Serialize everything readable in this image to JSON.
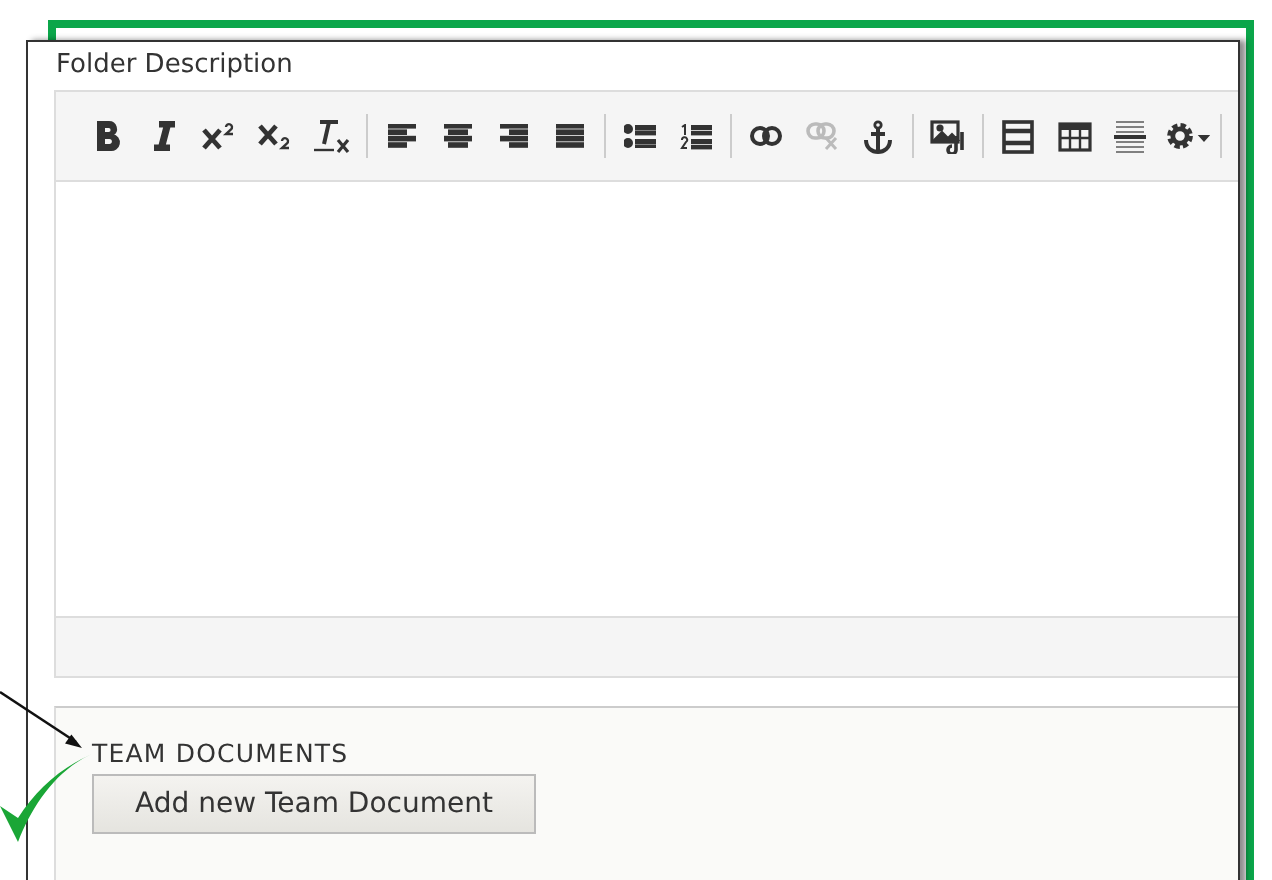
{
  "field_label": "Folder Description",
  "toolbar": [
    [
      {
        "kind": "bold",
        "disabled": false
      },
      {
        "kind": "italic",
        "disabled": false
      },
      {
        "kind": "superscript",
        "disabled": false
      },
      {
        "kind": "subscript",
        "disabled": false
      },
      {
        "kind": "clear-format",
        "disabled": false
      }
    ],
    [
      {
        "kind": "align-left",
        "disabled": false
      },
      {
        "kind": "align-center",
        "disabled": false
      },
      {
        "kind": "align-right",
        "disabled": false
      },
      {
        "kind": "justify",
        "disabled": false
      }
    ],
    [
      {
        "kind": "bullet-list",
        "disabled": false
      },
      {
        "kind": "numbered-list",
        "disabled": false
      }
    ],
    [
      {
        "kind": "link",
        "disabled": false
      },
      {
        "kind": "unlink",
        "disabled": true
      },
      {
        "kind": "anchor",
        "disabled": false
      }
    ],
    [
      {
        "kind": "image",
        "disabled": false
      }
    ],
    [
      {
        "kind": "template",
        "disabled": false
      },
      {
        "kind": "table",
        "disabled": false
      },
      {
        "kind": "horizontal-rule",
        "disabled": false
      },
      {
        "kind": "settings",
        "disabled": false
      }
    ]
  ],
  "section": {
    "heading": "TEAM DOCUMENTS",
    "button": "Add new Team Document"
  }
}
